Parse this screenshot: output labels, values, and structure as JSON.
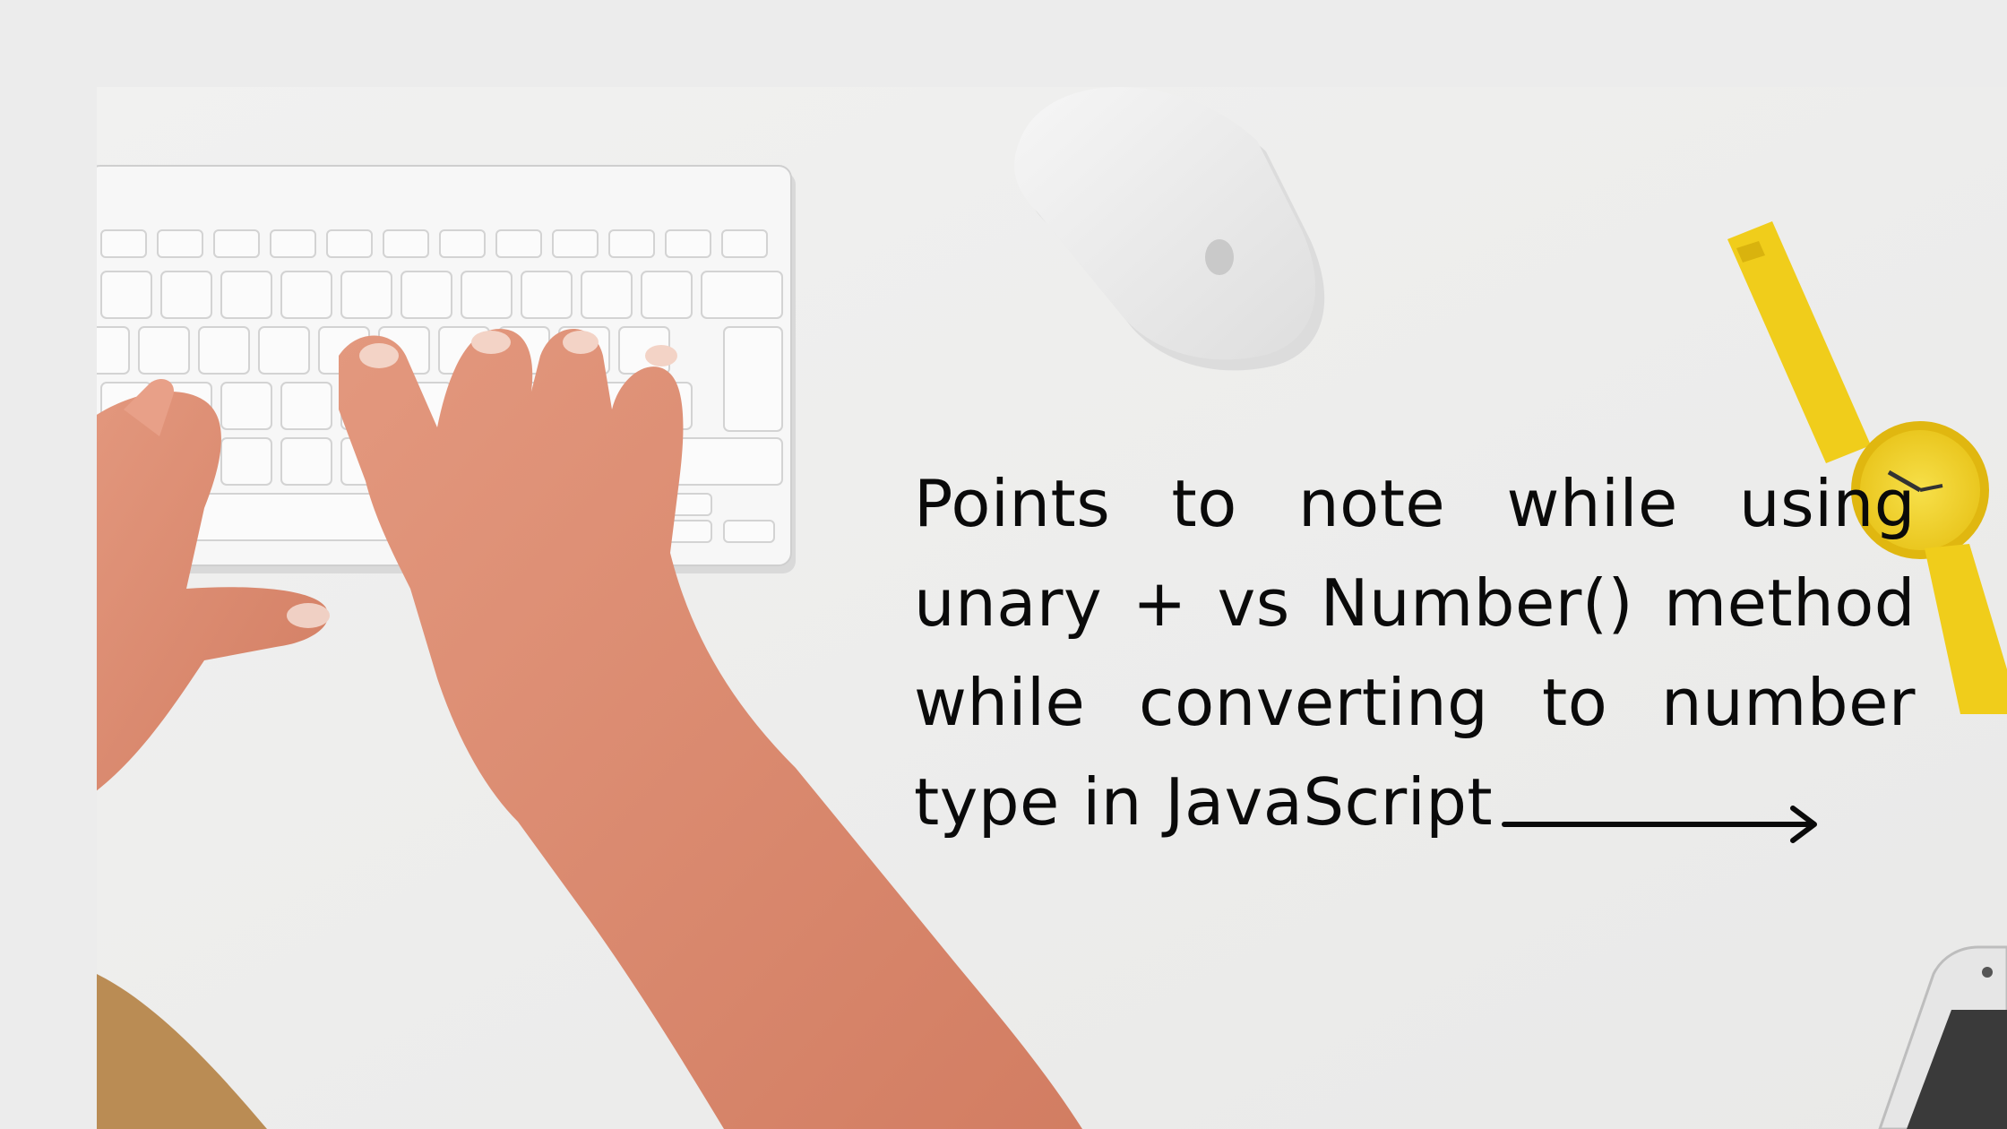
{
  "slide": {
    "headline": "Points to note while using unary + vs Number() method while converting to number type in JavaScript"
  },
  "icons": {
    "next": "arrow-right-icon"
  },
  "colors": {
    "background": "#ececec",
    "text": "#0a0a0a",
    "watch": "#f2d21f"
  }
}
